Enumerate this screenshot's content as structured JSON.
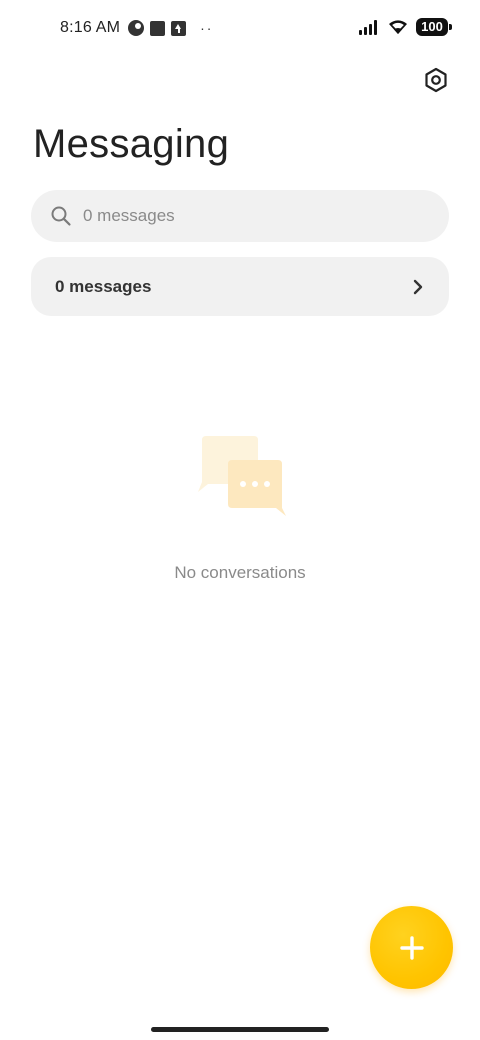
{
  "status_bar": {
    "time": "8:16 AM",
    "left_icons": [
      "data-saver-icon",
      "square-notification-icon",
      "upload-notification-icon",
      "more-notifications-icon"
    ],
    "more_dots": "··",
    "right_icons": [
      "signal-icon",
      "wifi-icon",
      "battery-icon"
    ],
    "battery_level": "100"
  },
  "header": {
    "title": "Messaging",
    "settings_icon": "settings-gear-icon"
  },
  "search": {
    "placeholder": "0 messages",
    "value": "",
    "icon": "search-icon"
  },
  "messages_row": {
    "label": "0 messages",
    "icon": "chevron-right-icon"
  },
  "empty_state": {
    "icon": "chat-bubbles-icon",
    "text": "No conversations"
  },
  "fab": {
    "icon": "plus-icon",
    "color": "#ffc400"
  },
  "colors": {
    "accent": "#ffc400",
    "surface": "#f1f1f1",
    "muted_text": "#8a8a8a"
  }
}
